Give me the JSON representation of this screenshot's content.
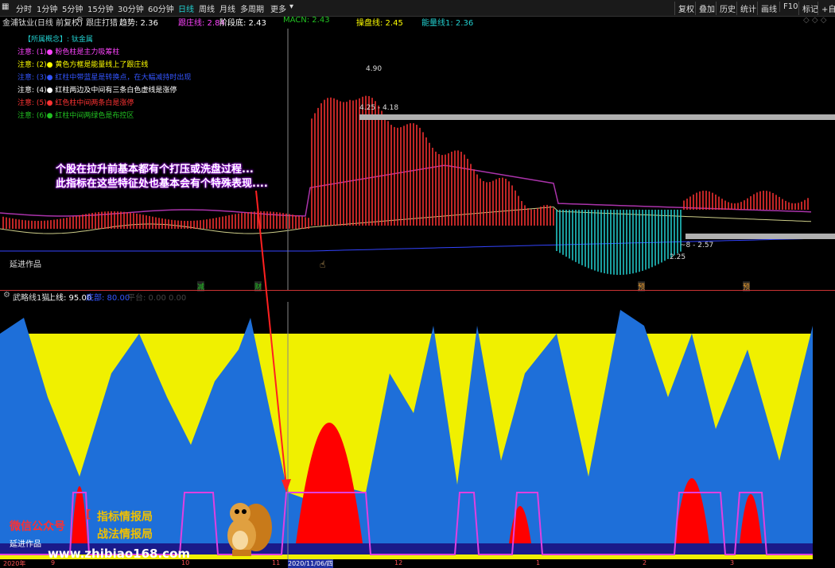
{
  "toolbar": {
    "periods": [
      "分时",
      "1分钟",
      "5分钟",
      "15分钟",
      "30分钟",
      "60分钟",
      "日线",
      "周线",
      "月线",
      "多周期",
      "更多"
    ],
    "active_period": "日线",
    "right_buttons": [
      "复权",
      "叠加",
      "历史",
      "统计",
      "画线",
      "F10",
      "标记",
      "+自"
    ]
  },
  "infobar": {
    "stock_title": "金浦钛业(日线 前复权)",
    "indicator_name": "跟庄打猎",
    "items": [
      {
        "label": "趋势: 2.36",
        "color": "#ffffff"
      },
      {
        "label": "跟庄线: 2.84",
        "color": "#ff44ff"
      },
      {
        "label": "阶段底: 2.43",
        "color": "#ffffff"
      },
      {
        "label": "MACN: 2.43",
        "color": "#22c022"
      },
      {
        "label": "操盘线: 2.45",
        "color": "#ffff00"
      },
      {
        "label": "能量线1: 2.36",
        "color": "#22d0d0"
      }
    ],
    "right_icons": "◇ ◇ ◇"
  },
  "notes": [
    {
      "text": "【所属概念】: 钛金属",
      "color": "#22d0d0"
    },
    {
      "text": "注意: (1)●  粉色柱是主力吸筹柱",
      "color": "#ff44ff"
    },
    {
      "text": "注意: (2)●  黄色方框是能量线上了跟庄线",
      "color": "#ffff00"
    },
    {
      "text": "注意: (3)●  红柱中带蓝星是转换点，在大幅减持时出现",
      "color": "#3355ff"
    },
    {
      "text": "注意: (4)●  红柱两边及中间有三条白色虚线是涨停",
      "color": "#ffffff"
    },
    {
      "text": "注意: (5)●  红色柱中间两条白是涨停",
      "color": "#ff3333"
    },
    {
      "text": "注意: (6)●  红柱中间两绿色是布控区",
      "color": "#22c022"
    }
  ],
  "price_labels": {
    "high": "4.90",
    "range_top": "4.25 - 4.18",
    "low": "2.25",
    "range_low": "~8 - 2.57"
  },
  "callout": {
    "line1": "个股在拉升前基本都有个打压或洗盘过程...",
    "line2": "此指标在这些特征处也基本会有个特殊表现...."
  },
  "author_label": "延进作品",
  "author_label_sub": "延进作品",
  "event_markers": [
    "减",
    "财",
    "预",
    "预"
  ],
  "sub_panel": {
    "title": "武略线1猫",
    "items": [
      {
        "label": "上线: 95.00",
        "color": "#ffffff"
      },
      {
        "label": "底部: 80.00",
        "color": "#3355ff"
      },
      {
        "label": "平台: 0.00 0.00",
        "color": "#444444"
      }
    ]
  },
  "date_axis": {
    "labels": [
      "2020年",
      "9",
      "10",
      "11",
      "2020/11/06/四",
      "12",
      "1",
      "2",
      "3"
    ]
  },
  "watermark": {
    "wechat_label": "微信公众号",
    "line1": "指标情报局",
    "line2": "战法情报局",
    "url": "www.zhibiao168.com"
  },
  "colors": {
    "up": "#ff3333",
    "down": "#22d0d0",
    "sub_yellow": "#f0f000",
    "sub_blue": "#1e6fd9",
    "sub_red": "#ff0000",
    "sub_navy": "#1a1a8a",
    "sub_pink": "#e040e0"
  }
}
